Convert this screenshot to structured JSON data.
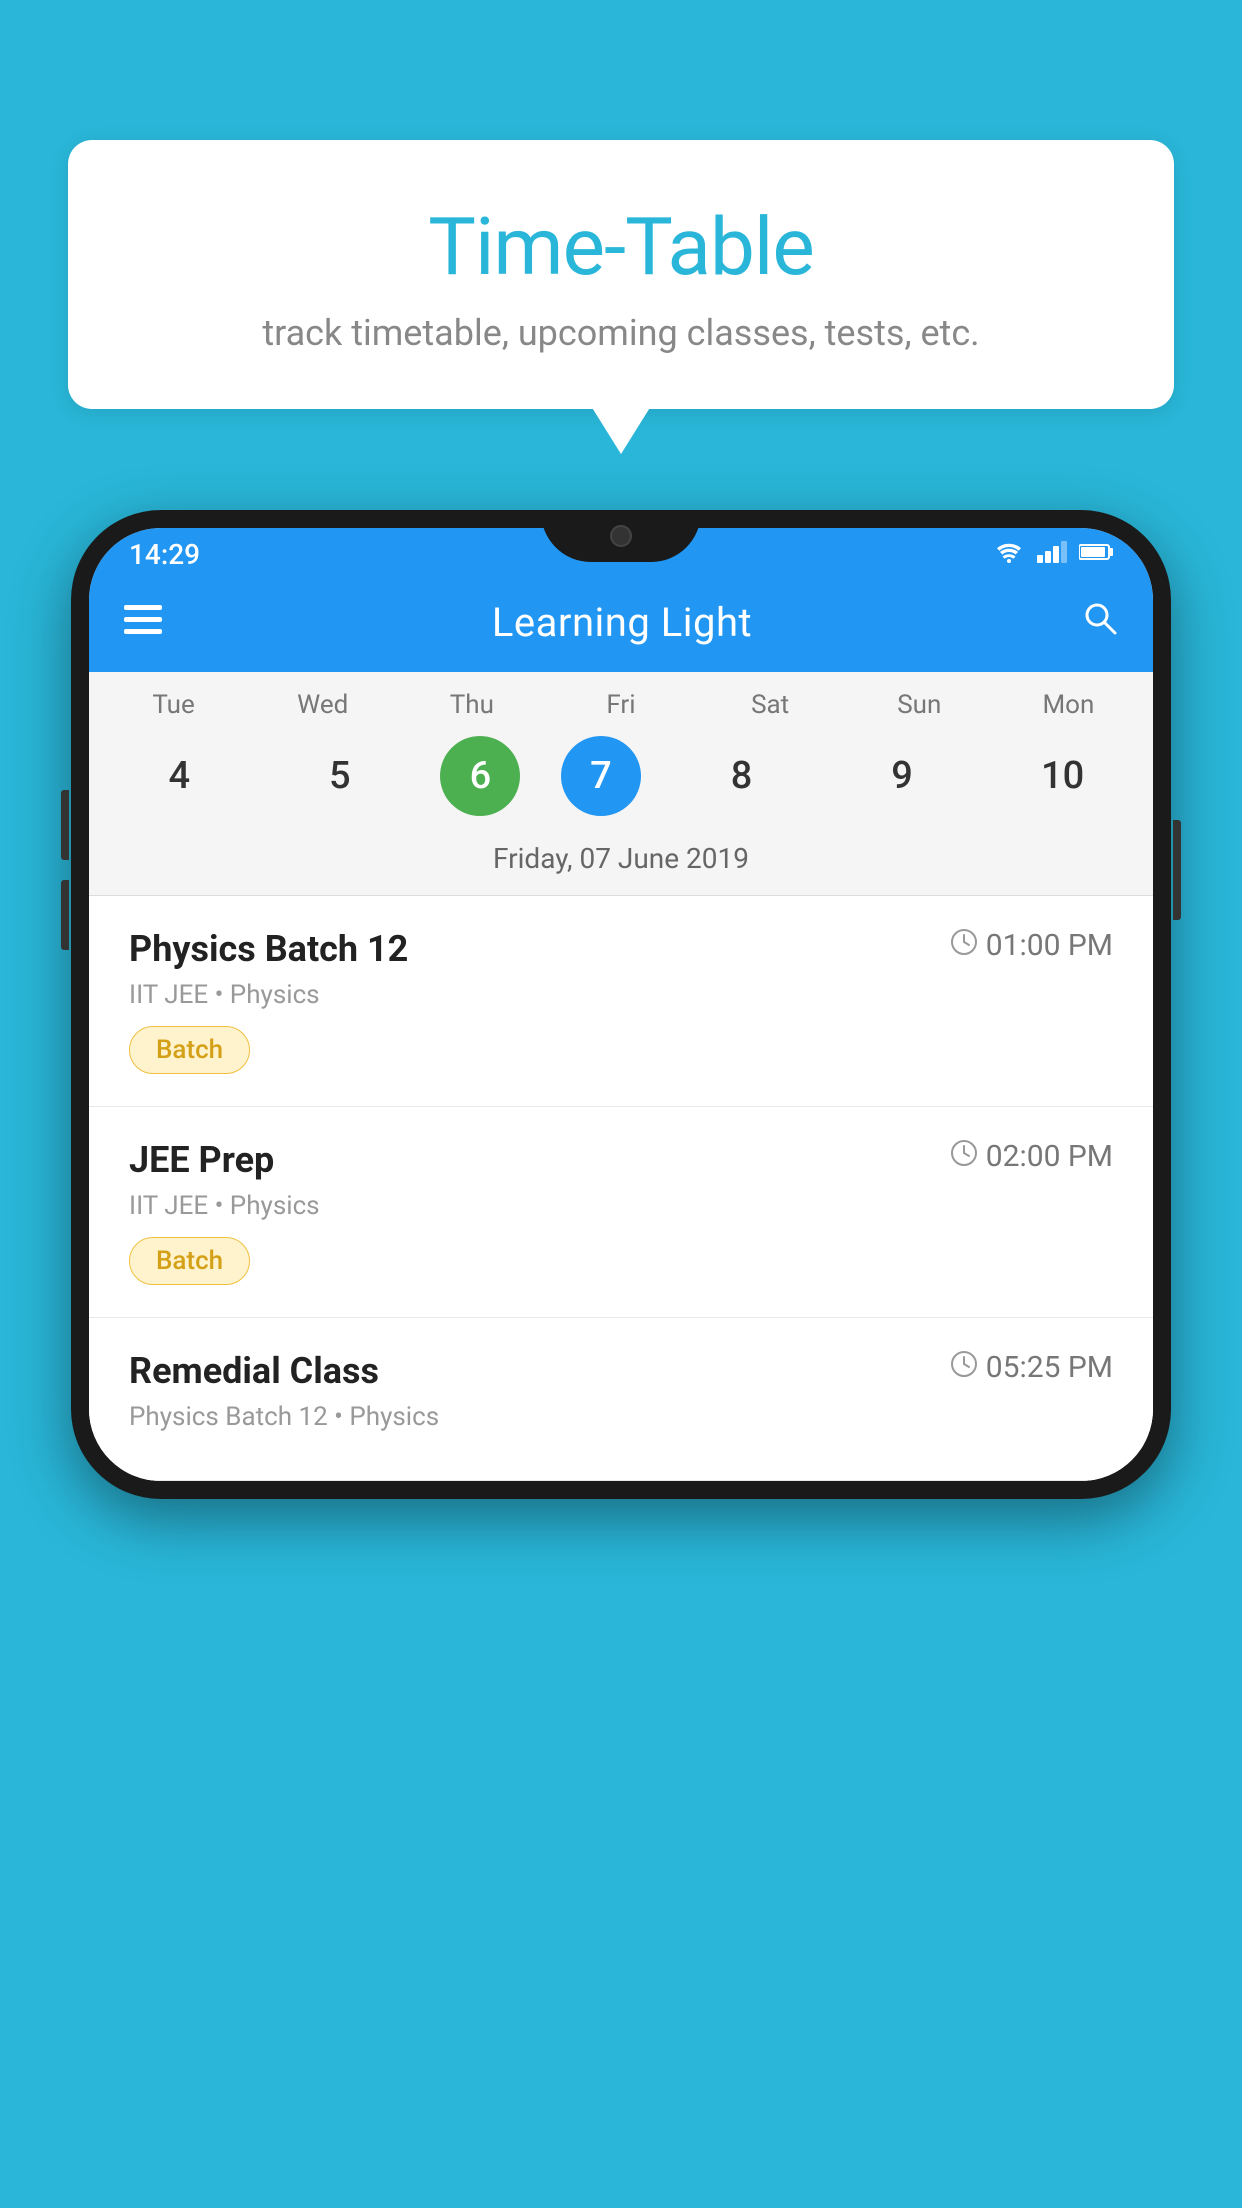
{
  "background_color": "#29b6d8",
  "speech_bubble": {
    "title": "Time-Table",
    "subtitle": "track timetable, upcoming classes, tests, etc."
  },
  "phone": {
    "status_bar": {
      "time": "14:29",
      "icons": [
        "wifi",
        "signal",
        "battery"
      ]
    },
    "app_bar": {
      "title": "Learning Light",
      "menu_icon": "☰",
      "search_icon": "search"
    },
    "calendar": {
      "days": [
        {
          "label": "Tue",
          "number": "4"
        },
        {
          "label": "Wed",
          "number": "5"
        },
        {
          "label": "Thu",
          "number": "6",
          "state": "today"
        },
        {
          "label": "Fri",
          "number": "7",
          "state": "selected"
        },
        {
          "label": "Sat",
          "number": "8"
        },
        {
          "label": "Sun",
          "number": "9"
        },
        {
          "label": "Mon",
          "number": "10"
        }
      ],
      "selected_date": "Friday, 07 June 2019"
    },
    "classes": [
      {
        "name": "Physics Batch 12",
        "time": "01:00 PM",
        "subtitle": "IIT JEE • Physics",
        "badge": "Batch"
      },
      {
        "name": "JEE Prep",
        "time": "02:00 PM",
        "subtitle": "IIT JEE • Physics",
        "badge": "Batch"
      },
      {
        "name": "Remedial Class",
        "time": "05:25 PM",
        "subtitle": "Physics Batch 12 • Physics",
        "badge": null
      }
    ]
  }
}
